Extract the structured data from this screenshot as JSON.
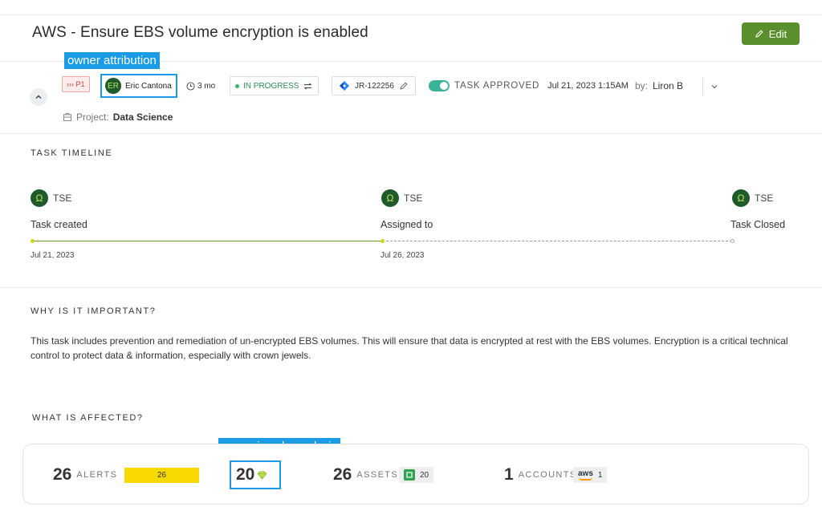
{
  "header": {
    "title": "AWS - Ensure EBS volume encryption is enabled",
    "edit_label": "Edit"
  },
  "annotations": {
    "owner": "owner attribution",
    "crown": "crown jewels analysis"
  },
  "task_meta": {
    "priority": "››› P1",
    "owner_initials": "ER",
    "owner_name": "Eric Cantona",
    "age": "3 mo",
    "status": "IN PROGRESS",
    "ticket": "JR-122256",
    "approved_label": "TASK APPROVED",
    "approved_date": "Jul 21, 2023 1:15AM",
    "approved_by_prefix": "by:",
    "approved_by": "Liron B",
    "project_prefix": "Project:",
    "project_name": "Data Science"
  },
  "timeline": {
    "heading": "TASK TIMELINE",
    "events": [
      {
        "user": "TSE",
        "label": "Task created",
        "date": "Jul 21, 2023"
      },
      {
        "user": "TSE",
        "label": "Assigned to",
        "date": "Jul 26, 2023"
      },
      {
        "user": "TSE",
        "label": "Task Closed",
        "date": ""
      }
    ]
  },
  "importance": {
    "heading": "WHY IS IT IMPORTANT?",
    "text": "This task includes prevention and remediation of un-encrypted EBS volumes. This will ensure that data is encrypted at rest with the EBS volumes. Encryption is a critical technical control to protect data & information, especially with crown jewels."
  },
  "affected": {
    "heading": "WHAT IS AFFECTED?",
    "alerts_count": "26",
    "alerts_label": "ALERTS",
    "alerts_bar_value": "26",
    "crown_count": "20",
    "assets_count": "26",
    "assets_label": "ASSETS",
    "assets_chip_value": "20",
    "accounts_count": "1",
    "accounts_label": "ACCOUNTS",
    "accounts_chip_logo": "aws",
    "accounts_chip_value": "1"
  },
  "colors": {
    "accent_green": "#5a8f2e",
    "annotation_blue": "#1a9be6",
    "alerts_yellow": "#f7d800"
  }
}
